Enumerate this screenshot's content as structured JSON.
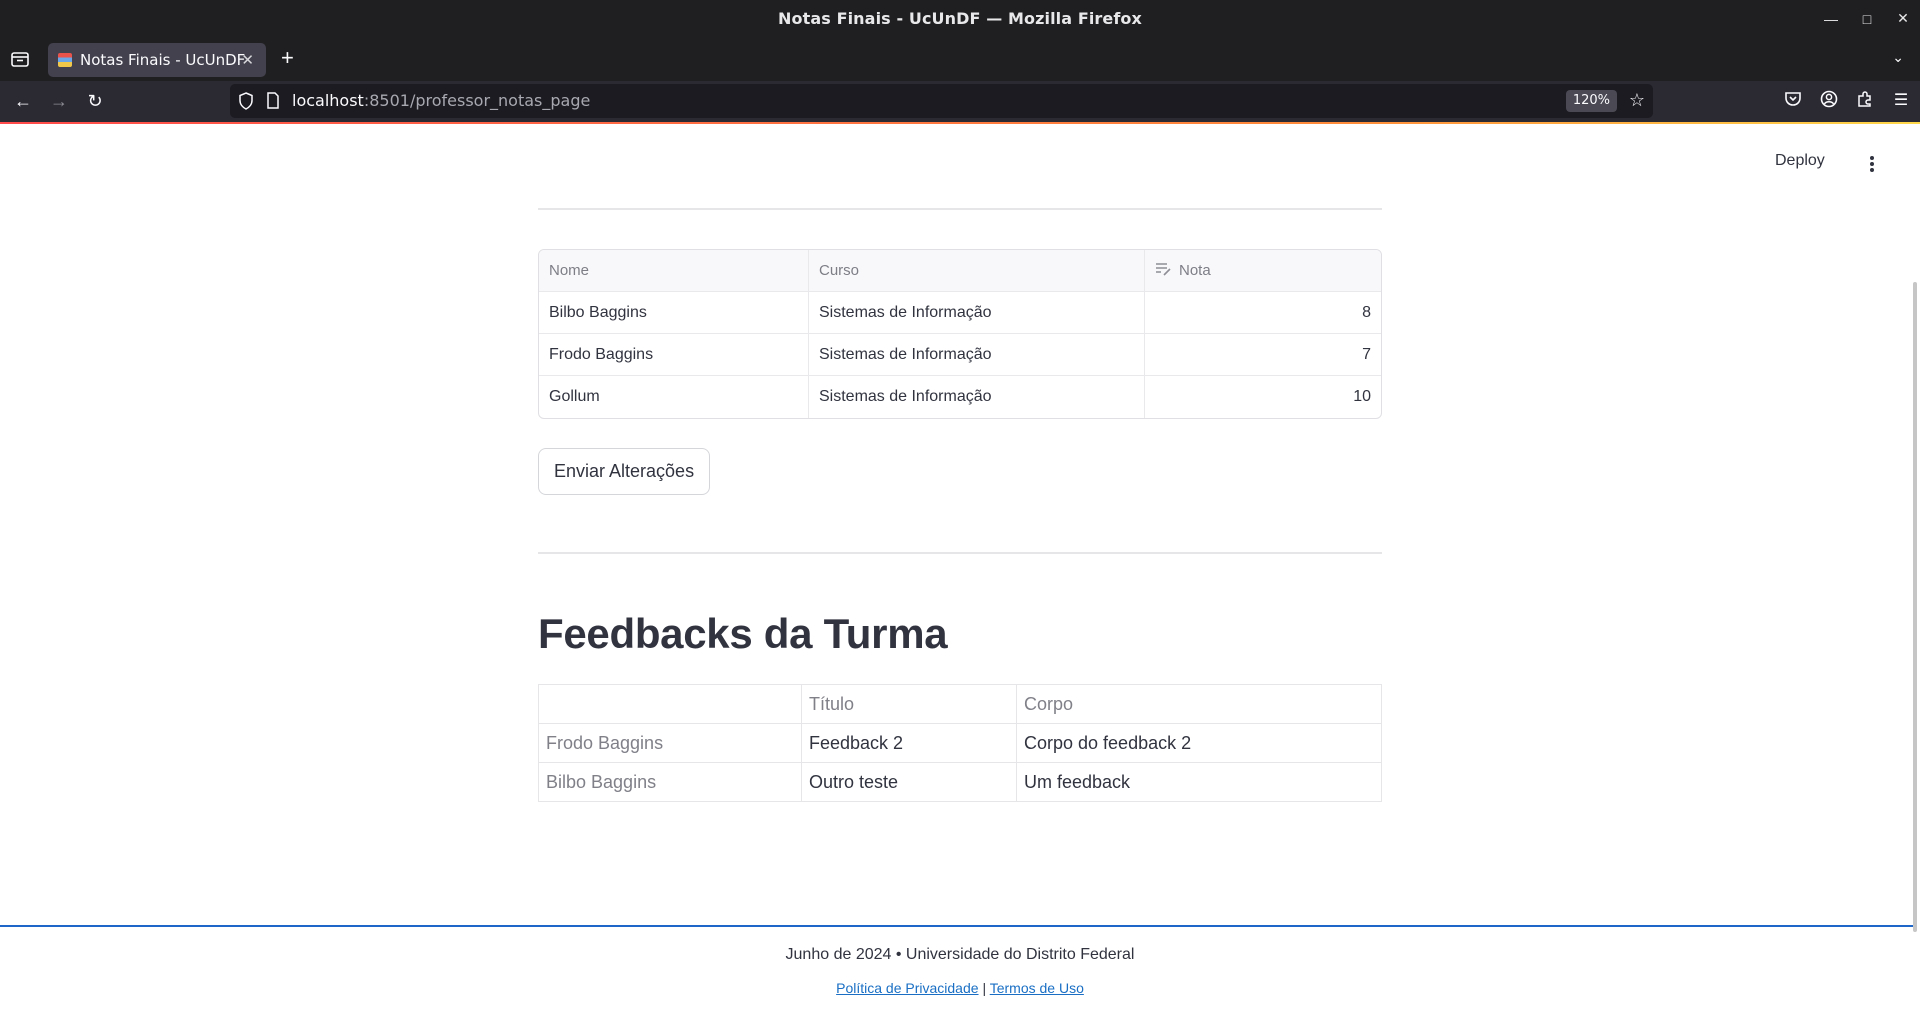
{
  "window": {
    "title": "Notas Finais - UcUnDF — Mozilla Firefox"
  },
  "browser": {
    "tab_title": "Notas Finais - UcUnDF",
    "url_host": "localhost",
    "url_rest": ":8501/professor_notas_page",
    "zoom": "120%"
  },
  "app": {
    "deploy_label": "Deploy"
  },
  "grades_table": {
    "headers": [
      "Nome",
      "Curso",
      "Nota"
    ],
    "rows": [
      {
        "nome": "Bilbo Baggins",
        "curso": "Sistemas de Informação",
        "nota": "8"
      },
      {
        "nome": "Frodo Baggins",
        "curso": "Sistemas de Informação",
        "nota": "7"
      },
      {
        "nome": "Gollum",
        "curso": "Sistemas de Informação",
        "nota": "10"
      }
    ]
  },
  "submit_button": "Enviar Alterações",
  "feedback_section": {
    "heading": "Feedbacks da Turma",
    "headers": [
      "",
      "Título",
      "Corpo"
    ],
    "rows": [
      {
        "aluno": "Frodo Baggins",
        "titulo": "Feedback 2",
        "corpo": "Corpo do feedback 2"
      },
      {
        "aluno": "Bilbo Baggins",
        "titulo": "Outro teste",
        "corpo": "Um feedback"
      }
    ]
  },
  "footer": {
    "text": "Junho de 2024 • Universidade do Distrito Federal",
    "privacy_link": "Política de Privacidade",
    "separator": "|",
    "terms_link": "Termos de Uso"
  },
  "icons": {
    "window_controls": [
      "minimize-icon",
      "maximize-icon",
      "close-icon"
    ],
    "nav": [
      "back-arrow-icon",
      "forward-arrow-icon",
      "reload-icon"
    ],
    "toolbar": [
      "pocket-icon",
      "account-icon",
      "extensions-icon",
      "menu-icon"
    ]
  }
}
